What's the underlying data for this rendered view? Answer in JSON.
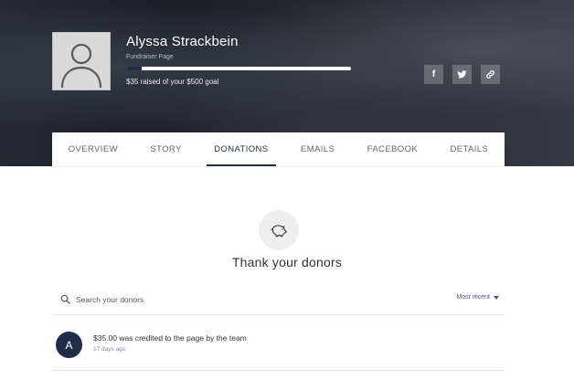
{
  "hero": {
    "name": "Alyssa Strackbein",
    "subtitle": "Fundraiser Page",
    "raised_text": "$35 raised of your $500 goal",
    "progress_fraction": 0.07
  },
  "social": {
    "facebook_glyph": "f",
    "icons": [
      "facebook-icon",
      "twitter-icon",
      "link-icon"
    ]
  },
  "tabs": [
    "OVERVIEW",
    "STORY",
    "DONATIONS",
    "EMAILS",
    "FACEBOOK",
    "DETAILS"
  ],
  "active_tab": "DONATIONS",
  "main": {
    "heading": "Thank your donors",
    "search_placeholder": "Search your donors",
    "sort_label": "Most recent"
  },
  "donations": [
    {
      "initial": "A",
      "text": "$35.00 was credited to the page by the team",
      "time": "17 days ago"
    }
  ],
  "colors": {
    "accent": "#1f2d4a",
    "muted_link": "#4a5877"
  }
}
